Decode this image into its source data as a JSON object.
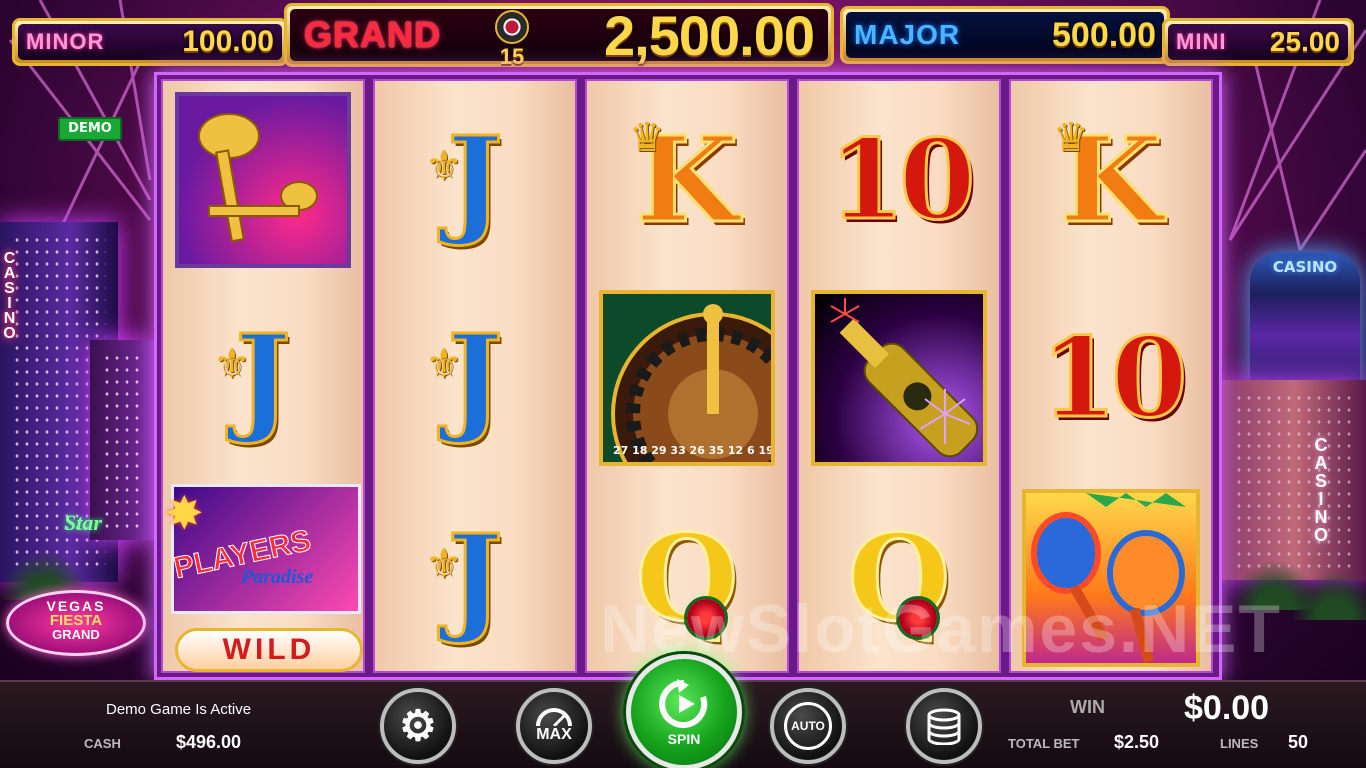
{
  "jackpots": {
    "minor": {
      "label": "MINOR",
      "value": "100.00"
    },
    "grand": {
      "label": "GRAND",
      "value": "2,500.00"
    },
    "grand_chip_number": "15",
    "major": {
      "label": "MAJOR",
      "value": "500.00"
    },
    "mini": {
      "label": "MINI",
      "value": "25.00"
    }
  },
  "demo_badge": "DEMO",
  "backdrop": {
    "left_casino_sign": "CASINO",
    "right_casino_sign": "CASINO",
    "right_tower_sign": "CASINO",
    "left_star_sign": "Star",
    "logo_line1": "VEGAS",
    "logo_line2": "FIESTA",
    "logo_line3": "GRAND"
  },
  "reels": [
    [
      "trumpet-symbol",
      "J",
      "wild-symbol"
    ],
    [
      "J",
      "J",
      "J"
    ],
    [
      "K",
      "roulette-symbol",
      "Q"
    ],
    [
      "10",
      "champagne-symbol",
      "Q"
    ],
    [
      "K",
      "10",
      "maracas-symbol"
    ]
  ],
  "wild_symbol": {
    "line1": "PLAYERS",
    "line2": "Paradise",
    "badge": "WILD"
  },
  "roulette_numbers": "27 18 29 33 26 35 12 6 19",
  "watermark": "NewSlotGames.NET",
  "bottom_bar": {
    "status": "Demo Game Is Active",
    "cash_label": "CASH",
    "cash_value": "$496.00",
    "win_label": "WIN",
    "win_value": "$0.00",
    "total_bet_label": "TOTAL BET",
    "total_bet_value": "$2.50",
    "lines_label": "LINES",
    "lines_value": "50",
    "max_label": "MAX",
    "spin_label": "SPIN",
    "auto_label": "AUTO"
  },
  "colors": {
    "spin_green": "#14a21c",
    "gold": "#e8b530",
    "reel_border": "#d266ff"
  }
}
